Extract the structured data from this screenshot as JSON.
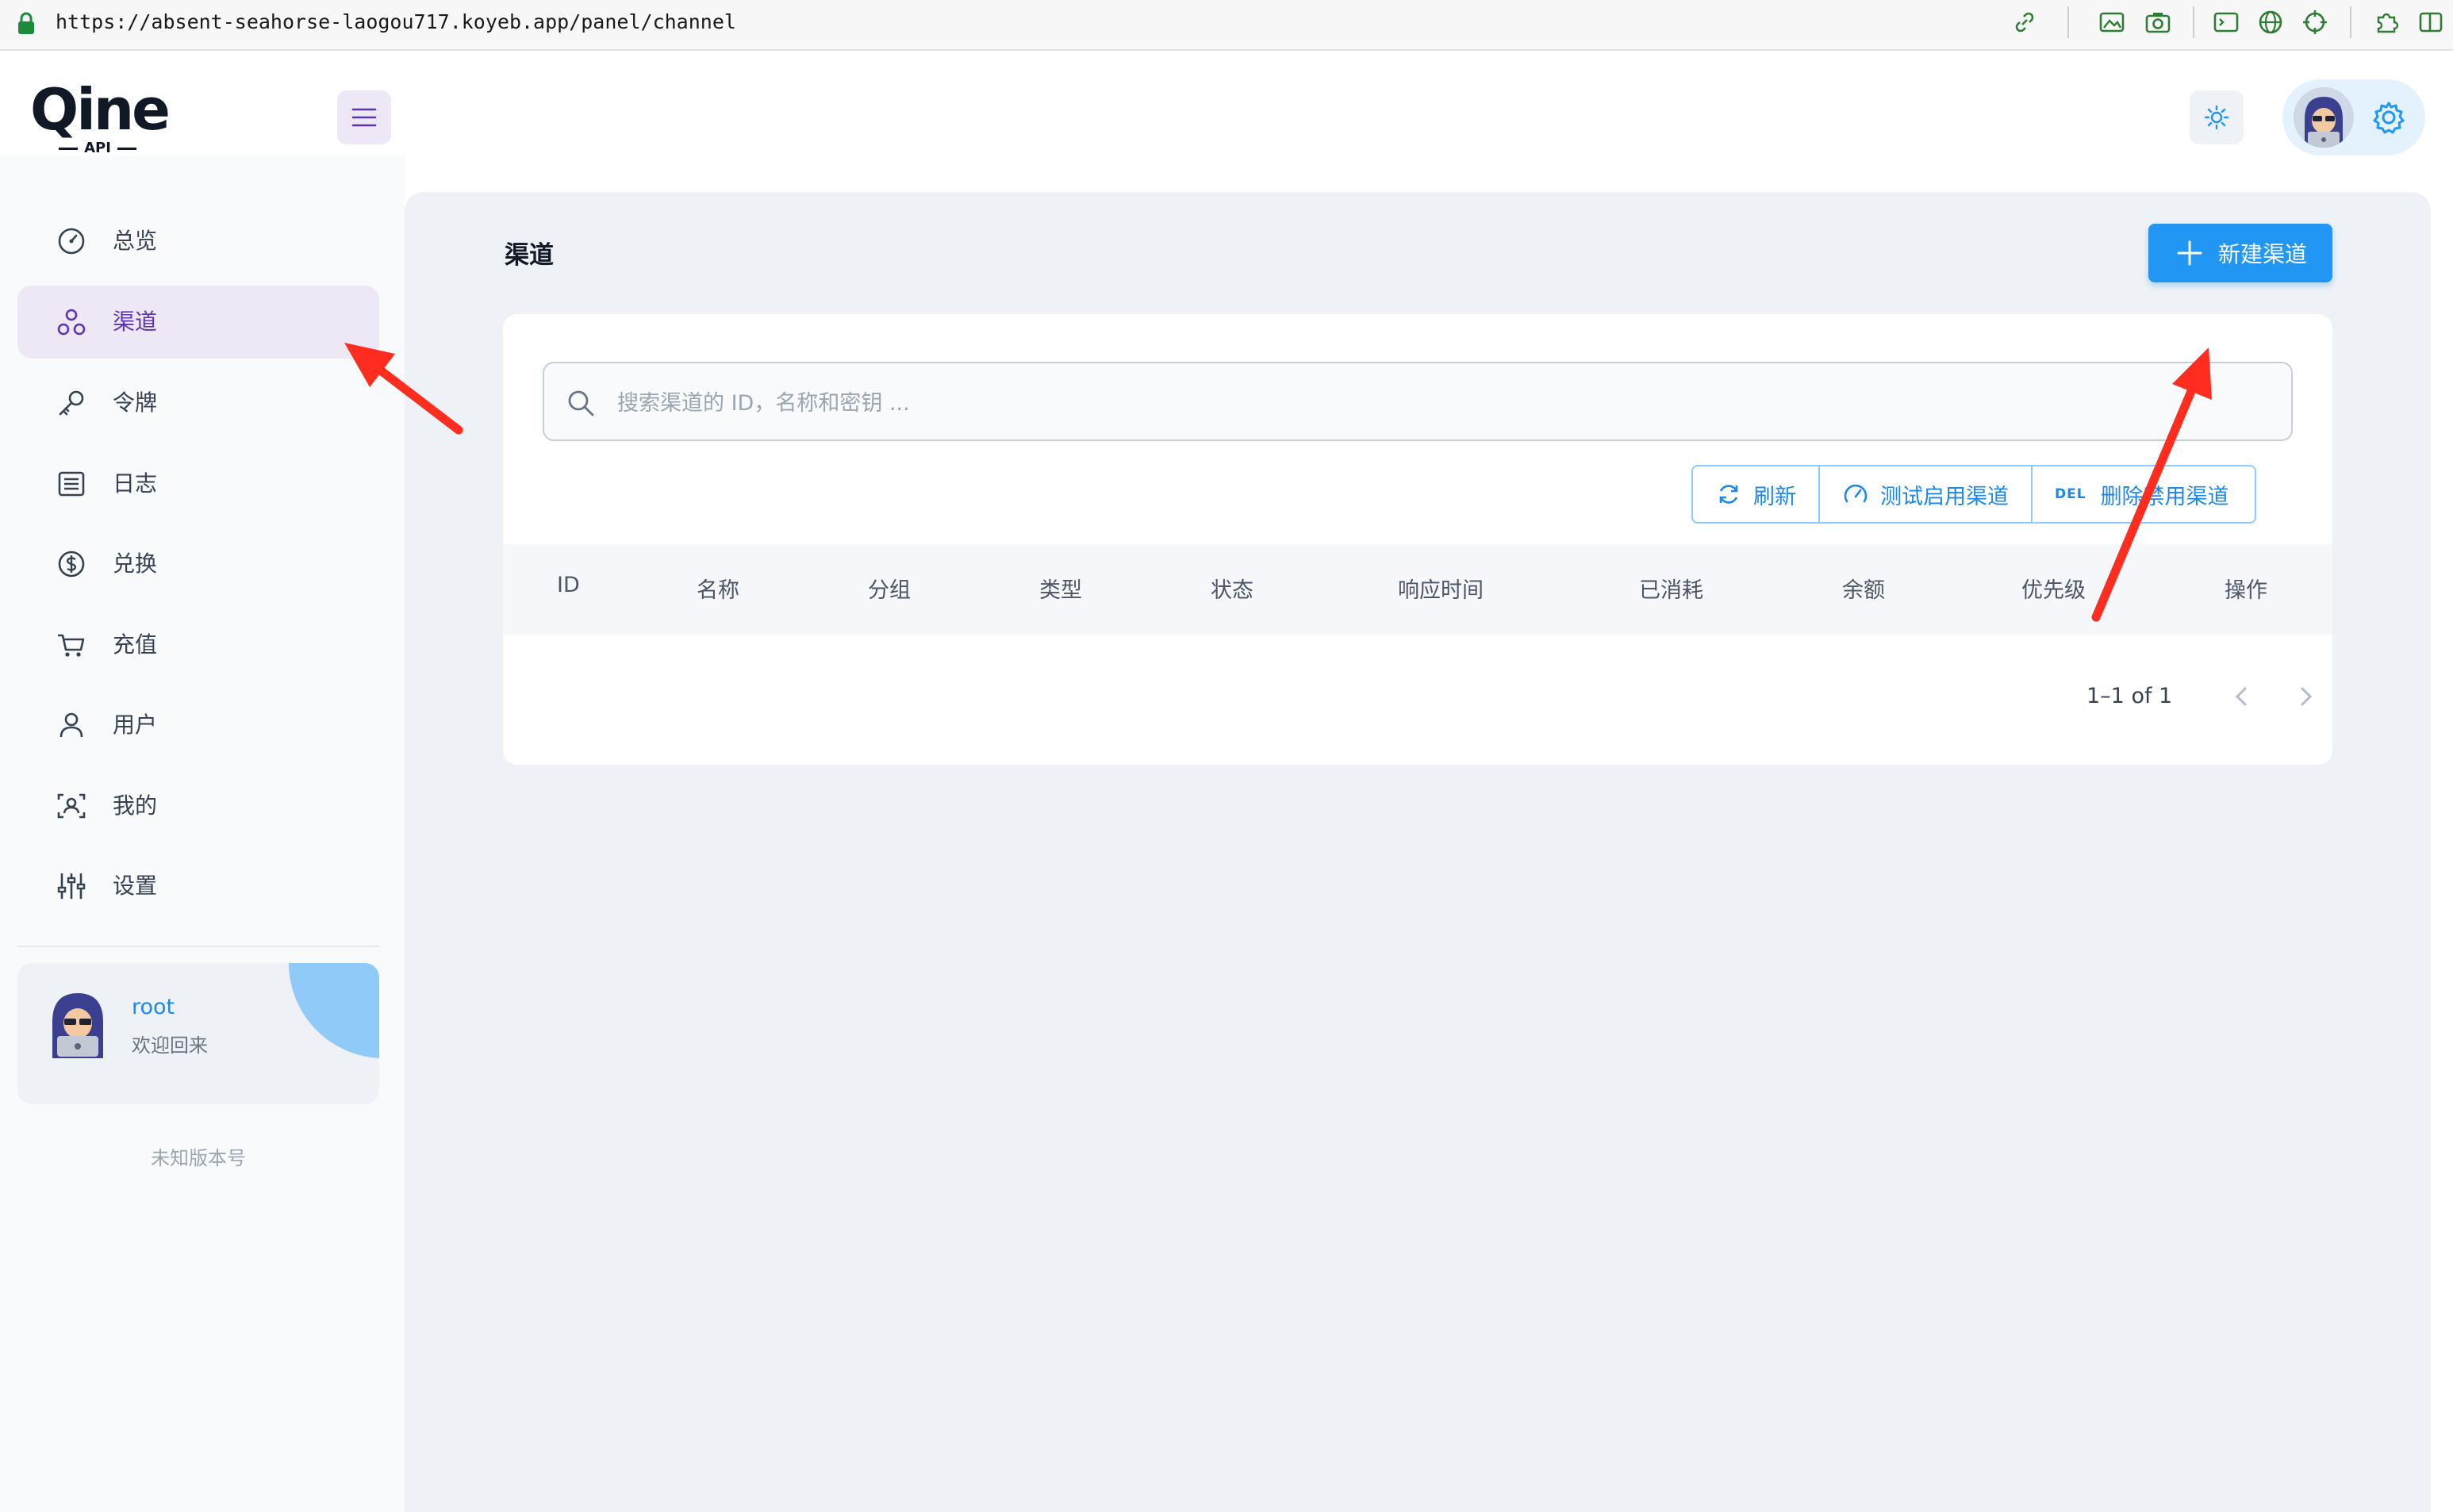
{
  "browser": {
    "url": "https://absent-seahorse-laogou717.koyeb.app/panel/channel"
  },
  "header": {
    "logo_text": "Qine",
    "logo_sub": "API"
  },
  "sidebar": {
    "items": [
      {
        "label": "总览",
        "icon": "dashboard-icon"
      },
      {
        "label": "渠道",
        "icon": "channel-icon",
        "active": true
      },
      {
        "label": "令牌",
        "icon": "key-icon"
      },
      {
        "label": "日志",
        "icon": "log-icon"
      },
      {
        "label": "兑换",
        "icon": "dollar-icon"
      },
      {
        "label": "充值",
        "icon": "cart-icon"
      },
      {
        "label": "用户",
        "icon": "user-icon"
      },
      {
        "label": "我的",
        "icon": "profile-scan-icon"
      },
      {
        "label": "设置",
        "icon": "settings-sliders-icon"
      }
    ],
    "user": {
      "name": "root",
      "greeting": "欢迎回来"
    },
    "version": "未知版本号"
  },
  "main": {
    "title": "渠道",
    "new_button": "新建渠道",
    "search_placeholder": "搜索渠道的 ID，名称和密钥 ...",
    "actions": {
      "refresh": "刷新",
      "test": "测试启用渠道",
      "del_tag": "DEL",
      "delete": "删除禁用渠道"
    },
    "columns": [
      "ID",
      "名称",
      "分组",
      "类型",
      "状态",
      "响应时间",
      "已消耗",
      "余额",
      "优先级",
      "操作"
    ],
    "pagination": "1–1 of 1"
  },
  "colors": {
    "accent": "#2196f3",
    "active_nav_bg": "#ede7f6",
    "active_nav_text": "#5e35b1",
    "annotation_arrow": "#ff2d20"
  }
}
